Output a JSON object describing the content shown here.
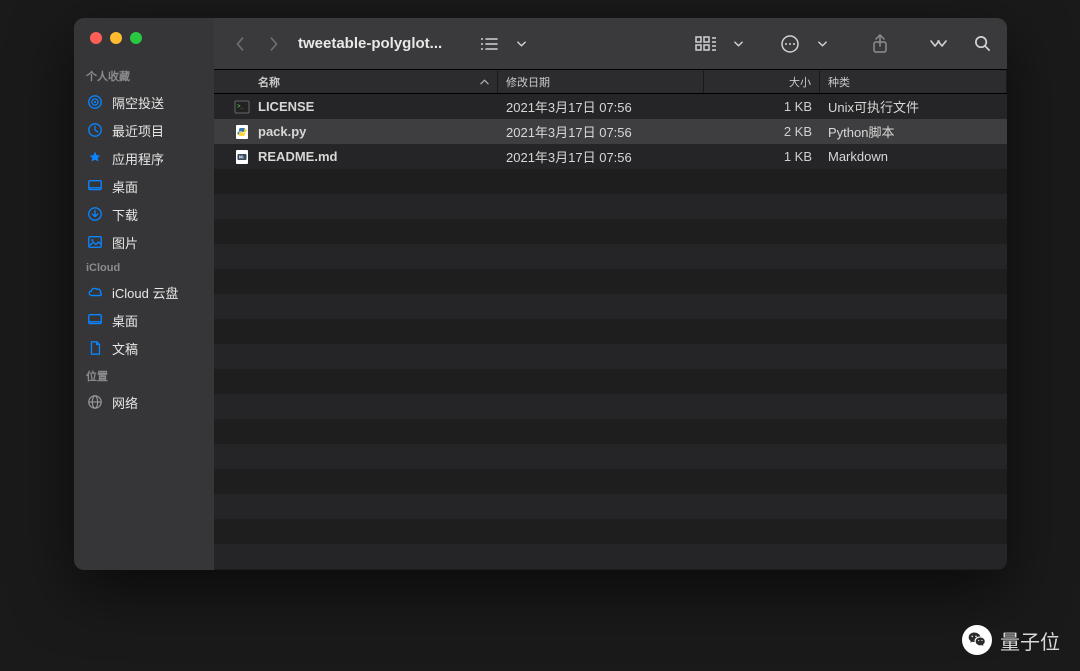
{
  "window": {
    "title": "tweetable-polyglot..."
  },
  "sidebar": {
    "groups": [
      {
        "label": "个人收藏",
        "items": [
          {
            "icon": "airdrop",
            "label": "隔空投送"
          },
          {
            "icon": "clock",
            "label": "最近项目"
          },
          {
            "icon": "apps",
            "label": "应用程序"
          },
          {
            "icon": "desktop",
            "label": "桌面"
          },
          {
            "icon": "download",
            "label": "下载"
          },
          {
            "icon": "pictures",
            "label": "图片"
          }
        ]
      },
      {
        "label": "iCloud",
        "items": [
          {
            "icon": "cloud",
            "label": "iCloud 云盘"
          },
          {
            "icon": "desktop",
            "label": "桌面"
          },
          {
            "icon": "doc",
            "label": "文稿"
          }
        ]
      },
      {
        "label": "位置",
        "items": [
          {
            "icon": "globe",
            "label": "网络"
          }
        ]
      }
    ]
  },
  "columns": {
    "name": "名称",
    "date": "修改日期",
    "size": "大小",
    "kind": "种类"
  },
  "files": [
    {
      "icon": "exec",
      "name": "LICENSE",
      "date": "2021年3月17日 07:56",
      "size": "1 KB",
      "kind": "Unix可执行文件",
      "selected": false
    },
    {
      "icon": "python",
      "name": "pack.py",
      "date": "2021年3月17日 07:56",
      "size": "2 KB",
      "kind": "Python脚本",
      "selected": true
    },
    {
      "icon": "markdown",
      "name": "README.md",
      "date": "2021年3月17日 07:56",
      "size": "1 KB",
      "kind": "Markdown",
      "selected": false
    }
  ],
  "watermark": {
    "text": "量子位"
  }
}
